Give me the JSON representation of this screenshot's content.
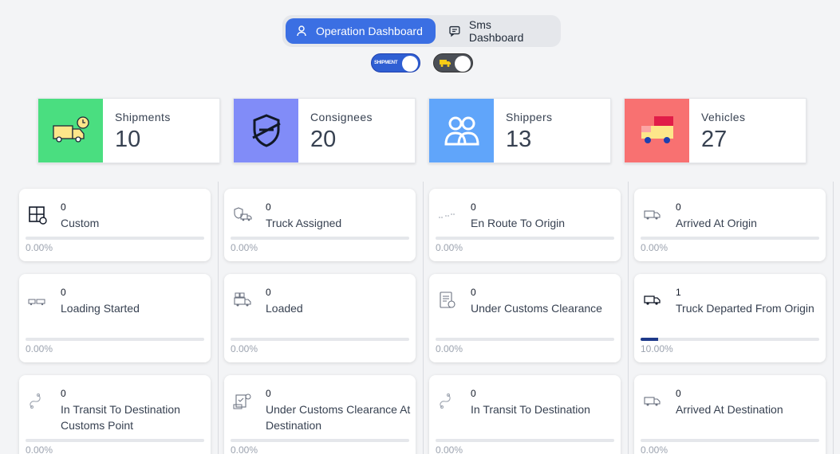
{
  "tabs": [
    {
      "label": "Operation Dashboard",
      "icon": "user-icon",
      "active": true
    },
    {
      "label": "Sms Dashboard",
      "icon": "chat-icon",
      "active": false
    }
  ],
  "toggles": {
    "shipment_label": "SHIPMENT",
    "shipment_on": true,
    "vehicle_icon": "truck-icon",
    "vehicle_on": true
  },
  "stats": [
    {
      "label": "Shipments",
      "value": "10",
      "color": "#4ade80",
      "icon": "truck-clock-icon"
    },
    {
      "label": "Consignees",
      "value": "20",
      "color": "#818cf8",
      "icon": "shield-icon"
    },
    {
      "label": "Shippers",
      "value": "13",
      "color": "#60a5fa",
      "icon": "users-icon"
    },
    {
      "label": "Vehicles",
      "value": "27",
      "color": "#f87171",
      "icon": "delivery-truck-icon"
    }
  ],
  "statuses": [
    {
      "count": "0",
      "label": "Custom",
      "percent": "0.00%",
      "progress": 0,
      "icon": "calculator-icon"
    },
    {
      "count": "0",
      "label": "Truck Assigned",
      "percent": "0.00%",
      "progress": 0,
      "icon": "truck-check-icon"
    },
    {
      "count": "0",
      "label": "En Route To Origin",
      "percent": "0.00%",
      "progress": 0,
      "icon": "route-icon"
    },
    {
      "count": "0",
      "label": "Arrived At Origin",
      "percent": "0.00%",
      "progress": 0,
      "icon": "truck-arrive-icon"
    },
    {
      "count": "0",
      "label": "Loading Started",
      "percent": "0.00%",
      "progress": 0,
      "icon": "loading-icon"
    },
    {
      "count": "0",
      "label": "Loaded",
      "percent": "0.00%",
      "progress": 0,
      "icon": "truck-loaded-icon"
    },
    {
      "count": "0",
      "label": "Under Customs Clearance",
      "percent": "0.00%",
      "progress": 0,
      "icon": "clipboard-icon"
    },
    {
      "count": "1",
      "label": "Truck Departed From Origin",
      "percent": "10.00%",
      "progress": 0.1,
      "icon": "truck-depart-icon"
    },
    {
      "count": "0",
      "label": "In Transit To Destination Customs Point",
      "percent": "0.00%",
      "progress": 0,
      "icon": "transit-path-icon"
    },
    {
      "count": "0",
      "label": "Under Customs Clearance At Destination",
      "percent": "0.00%",
      "progress": 0,
      "icon": "customs-doc-icon"
    },
    {
      "count": "0",
      "label": "In Transit To Destination",
      "percent": "0.00%",
      "progress": 0,
      "icon": "transit-path-icon"
    },
    {
      "count": "0",
      "label": "Arrived At Destination",
      "percent": "0.00%",
      "progress": 0,
      "icon": "truck-arrive-icon"
    }
  ]
}
